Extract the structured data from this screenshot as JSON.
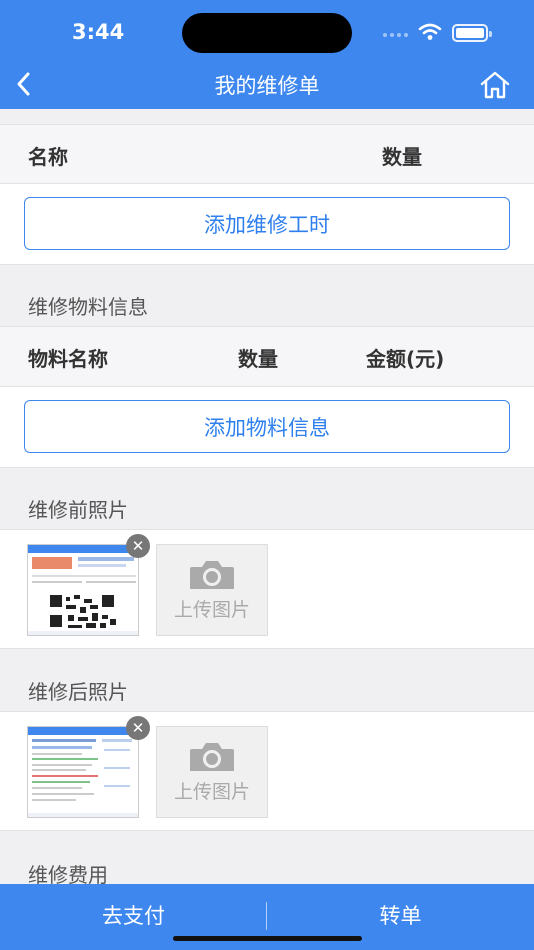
{
  "status_bar": {
    "time": "3:44"
  },
  "nav": {
    "title": "我的维修单",
    "back_icon": "chevron-left-icon",
    "home_icon": "home-icon"
  },
  "labor": {
    "columns": [
      "名称",
      "数量"
    ],
    "add_button": "添加维修工时"
  },
  "materials": {
    "section_title": "维修物料信息",
    "columns": [
      "物料名称",
      "数量",
      "金额(元)"
    ],
    "add_button": "添加物料信息"
  },
  "before_photos": {
    "section_title": "维修前照片",
    "upload_label": "上传图片"
  },
  "after_photos": {
    "section_title": "维修后照片",
    "upload_label": "上传图片"
  },
  "fees": {
    "section_title": "维修费用"
  },
  "bottom_bar": {
    "pay_label": "去支付",
    "transfer_label": "转单"
  },
  "colors": {
    "primary": "#3d87ee",
    "background": "#f0f0f2"
  }
}
